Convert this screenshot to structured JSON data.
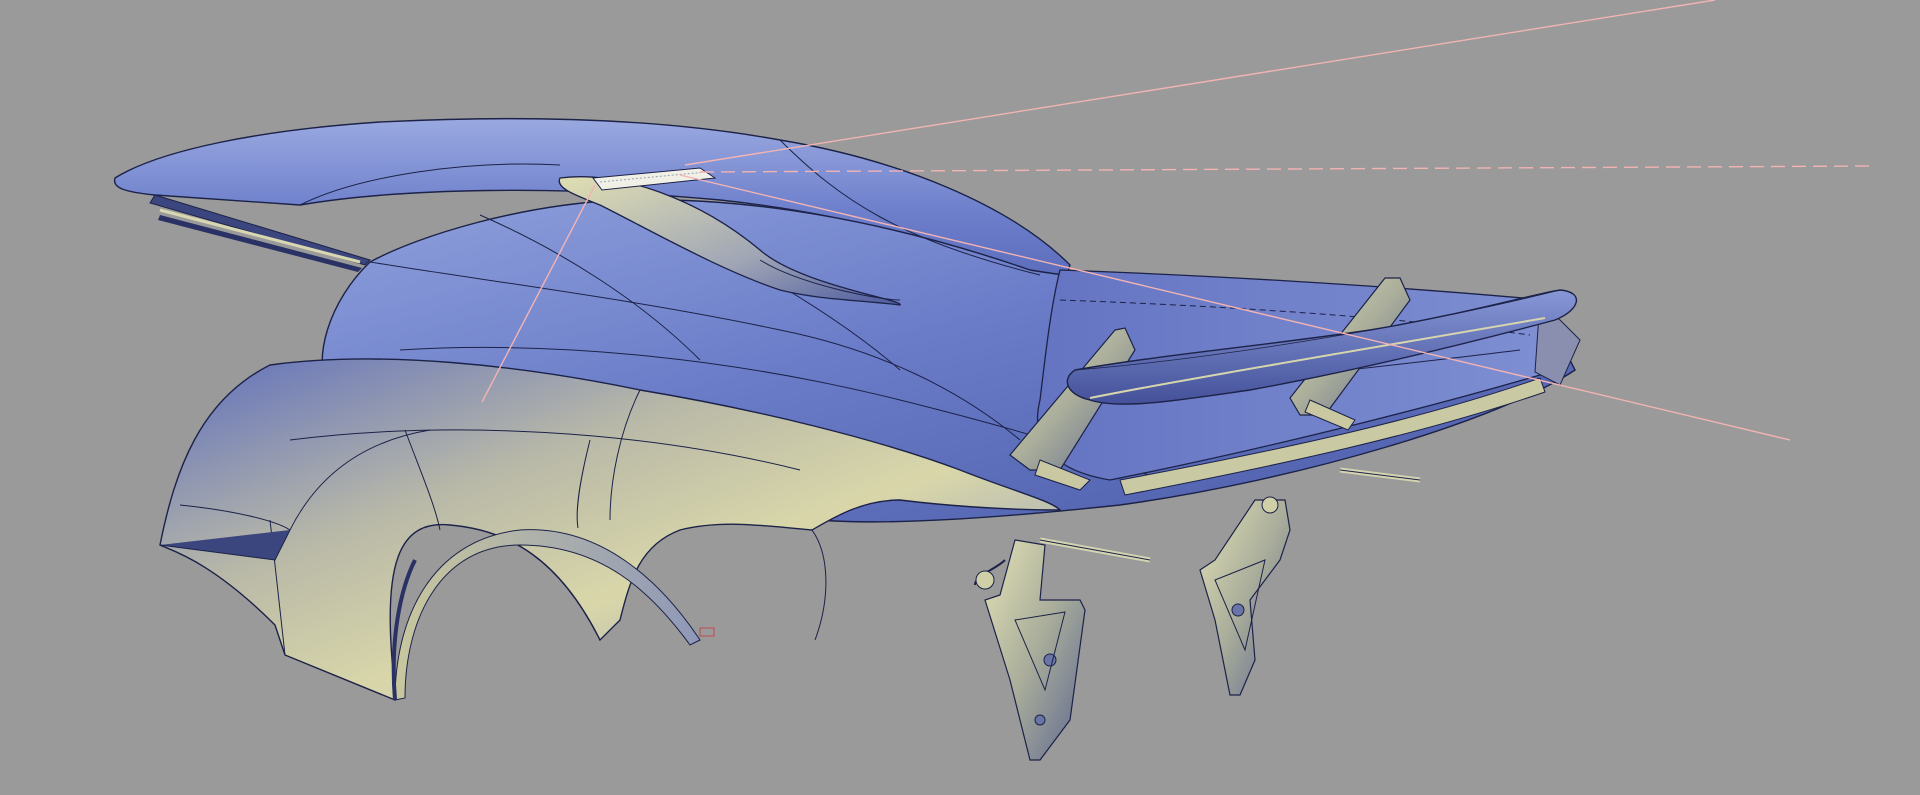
{
  "viewport": {
    "background": "#9a9a9a",
    "render_mode": "shaded-with-edges",
    "colors": {
      "body_highlight": "#8a9bd6",
      "body_mid": "#5f70c0",
      "body_shadow": "#3f4c92",
      "chrome_warm": "#d7d6a8",
      "edge_line": "#1c2248",
      "guide_line": "#f2b3b3"
    }
  },
  "model": {
    "parts": [
      "rear-body-shell",
      "roof-canopy",
      "rear-wheel-arch",
      "roof-air-intake",
      "rear-wing",
      "wing-strut-left",
      "wing-strut-right",
      "suspension-upright-left",
      "suspension-upright-right",
      "rear-diffuser-frame"
    ]
  },
  "guides": [
    "guide-line-upper",
    "guide-line-center-dashed",
    "guide-line-lower",
    "guide-line-down"
  ]
}
